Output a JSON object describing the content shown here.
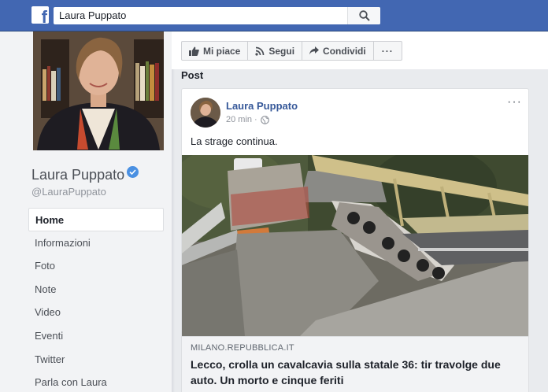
{
  "topbar": {
    "logo_letter": "f",
    "search_value": "Laura Puppato"
  },
  "profile": {
    "name": "Laura Puppato",
    "handle": "@LauraPuppato"
  },
  "nav": {
    "items": [
      {
        "label": "Home",
        "active": true
      },
      {
        "label": "Informazioni"
      },
      {
        "label": "Foto"
      },
      {
        "label": "Note"
      },
      {
        "label": "Video"
      },
      {
        "label": "Eventi"
      },
      {
        "label": "Twitter"
      },
      {
        "label": "Parla con Laura"
      }
    ]
  },
  "actions": {
    "like": "Mi piace",
    "follow": "Segui",
    "share": "Condividi",
    "more": "···"
  },
  "section_title": "Post",
  "post": {
    "author": "Laura Puppato",
    "time": "20 min",
    "more": "···",
    "text": "La strage continua.",
    "link_domain": "MILANO.REPUBBLICA.IT",
    "link_title": "Lecco, crolla un cavalcavia sulla statale 36: tir travolge due auto. Un morto e cinque feriti"
  },
  "colors": {
    "brand": "#4267b2",
    "link": "#365899",
    "verified": "#4a90e2"
  }
}
